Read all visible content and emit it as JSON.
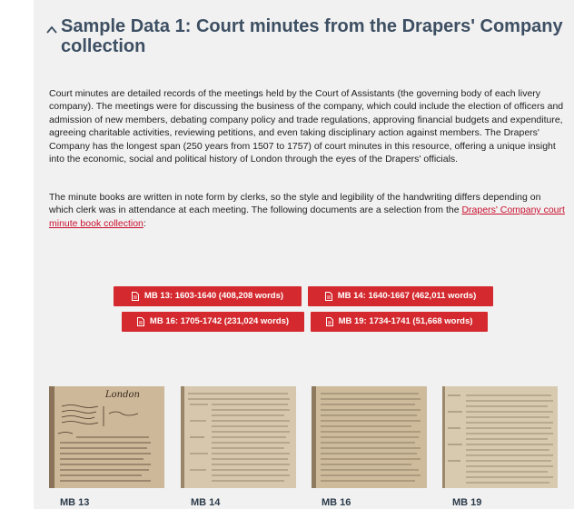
{
  "section": {
    "title": "Sample Data 1: Court minutes from the Drapers' Company collection"
  },
  "body": {
    "paragraph1": "Court minutes are detailed records of the meetings held by the Court of Assistants (the governing body of each livery company). The meetings were for discussing the business of the company, which could include the election of officers and admission of new members, debating company policy and trade regulations, approving financial budgets and expenditure, agreeing charitable activities, reviewing petitions, and even taking disciplinary action against members. The Drapers' Company has the longest span (250 years from 1507 to 1757) of court minutes in this resource, offering a unique insight into the economic, social and political history of London through the eyes of the Drapers' officials.",
    "paragraph2_text": "The minute books are written in note form by clerks, so the style and legibility of the handwriting differs depending on which clerk was in attendance at each meeting. The following documents are a selection from the ",
    "paragraph2_link": "Drapers' Company court minute book collection",
    "paragraph2_end": ":"
  },
  "downloads": [
    {
      "label": "MB 13: 1603-1640 (408,208 words)"
    },
    {
      "label": "MB 14: 1640-1667 (462,011 words)"
    },
    {
      "label": "MB 16: 1705-1742 (231,024 words)"
    },
    {
      "label": "MB 19: 1734-1741 (51,668 words)"
    }
  ],
  "gallery": [
    {
      "caption": "MB 13",
      "heading": "London"
    },
    {
      "caption": "MB 14"
    },
    {
      "caption": "MB 16"
    },
    {
      "caption": "MB 19"
    }
  ],
  "colors": {
    "panel_bg": "#f1f1f1",
    "title": "#3d4f63",
    "button": "#d42a2f",
    "link": "#c8102e"
  },
  "icons": {
    "collapse": "chevron-up-icon",
    "download": "document-icon"
  }
}
